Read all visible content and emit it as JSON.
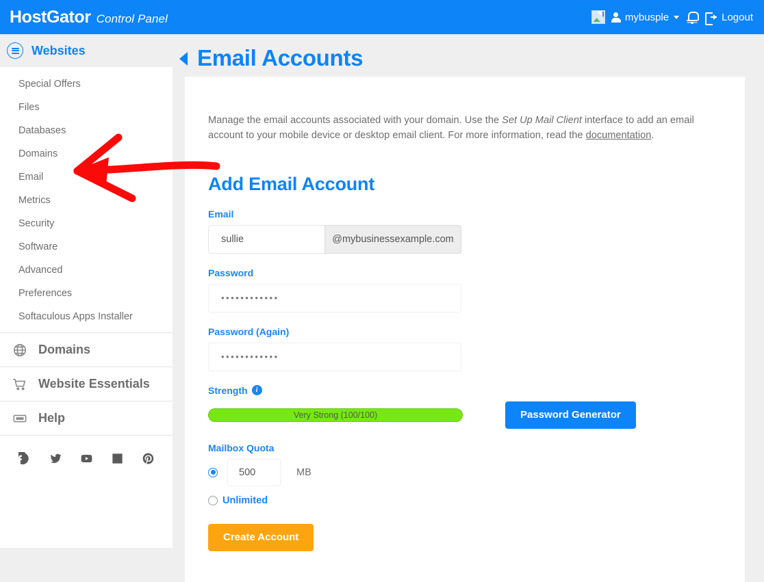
{
  "header": {
    "brand_name": "HostGator",
    "brand_subtitle": "Control Panel",
    "avatar_icon": "broken-image-icon",
    "person_icon": "person-icon",
    "username": "mybusple",
    "caret_icon": "chevron-down-icon",
    "bell_icon": "notification-bell-icon",
    "logout_icon": "logout-icon",
    "logout_label": "Logout"
  },
  "sidebar": {
    "header": {
      "icon": "server-stack-icon",
      "label": "Websites"
    },
    "items": [
      {
        "label": "Special Offers"
      },
      {
        "label": "Files"
      },
      {
        "label": "Databases"
      },
      {
        "label": "Domains"
      },
      {
        "label": "Email"
      },
      {
        "label": "Metrics"
      },
      {
        "label": "Security"
      },
      {
        "label": "Software"
      },
      {
        "label": "Advanced"
      },
      {
        "label": "Preferences"
      },
      {
        "label": "Softaculous Apps Installer"
      }
    ],
    "sections": [
      {
        "label": "Domains",
        "icon": "globe-icon"
      },
      {
        "label": "Website Essentials",
        "icon": "shopping-cart-icon"
      },
      {
        "label": "Help",
        "icon": "ticket-icon"
      }
    ],
    "social": [
      {
        "name": "facebook-icon"
      },
      {
        "name": "twitter-icon"
      },
      {
        "name": "youtube-icon"
      },
      {
        "name": "linkedin-icon"
      },
      {
        "name": "pinterest-icon"
      }
    ]
  },
  "page": {
    "back_icon": "back-triangle-icon",
    "title": "Email Accounts",
    "description_part1": "Manage the email accounts associated with your domain. Use the ",
    "description_emphasis": "Set Up Mail Client",
    "description_part2": " interface to add an email account to your mobile device or desktop email client. For more information, read the ",
    "description_link": "documentation",
    "description_part3": "."
  },
  "form": {
    "section_title": "Add Email Account",
    "email_label": "Email",
    "email_value": "sullie",
    "email_domain": "@mybusinessexample.com",
    "password_label": "Password",
    "password_value": "••••••••••••",
    "password_again_label": "Password (Again)",
    "password_again_value": "••••••••••••",
    "strength_label": "Strength",
    "strength_info_icon": "info-icon",
    "strength_text": "Very Strong (100/100)",
    "strength_value": 100,
    "strength_max": 100,
    "strength_color": "#77e814",
    "generator_button": "Password Generator",
    "quota_label": "Mailbox Quota",
    "quota_value": "500",
    "quota_unit": "MB",
    "quota_selected": "limited",
    "unlimited_label": "Unlimited",
    "submit_label": "Create Account"
  },
  "annotation": {
    "type": "hand-drawn-arrow",
    "color": "#fb0a0a",
    "points_to": "Email"
  },
  "colors": {
    "brand_blue": "#0d84f7",
    "accent_orange": "#fca510",
    "page_bg": "#efefef"
  }
}
